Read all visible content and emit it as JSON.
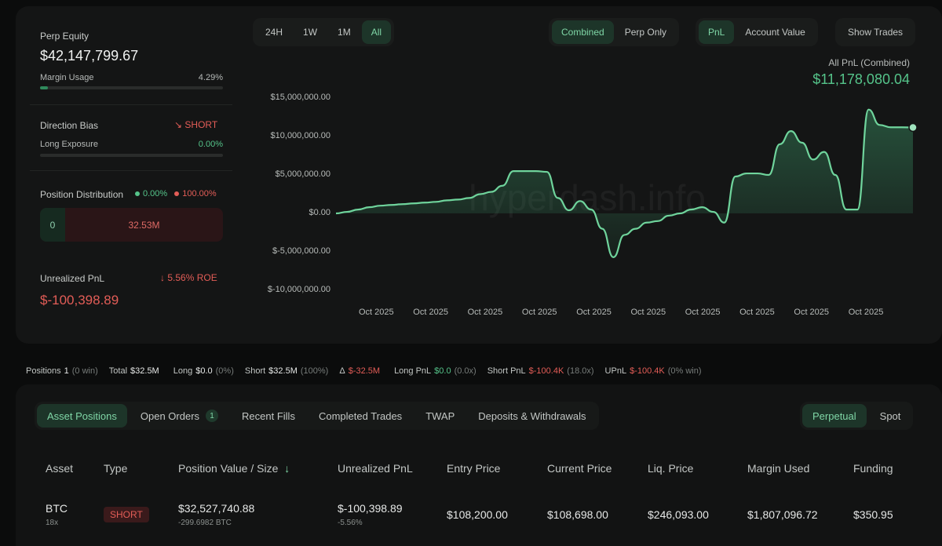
{
  "summary": {
    "perp_equity_label": "Perp Equity",
    "perp_equity_value": "$42,147,799.67",
    "margin_usage_label": "Margin Usage",
    "margin_usage_value": "4.29%",
    "margin_usage_fraction": 0.0429,
    "direction_bias_label": "Direction Bias",
    "direction_bias_value": "SHORT",
    "long_exposure_label": "Long Exposure",
    "long_exposure_value": "0.00%",
    "long_exposure_fraction": 0,
    "position_distribution_label": "Position Distribution",
    "dist_long_pct": "0.00%",
    "dist_short_pct": "100.00%",
    "dist_long_value": "0",
    "dist_short_value": "32.53M",
    "unrealized_pnl_label": "Unrealized PnL",
    "roe_value": "5.56% ROE",
    "unrealized_pnl_value": "$-100,398.89"
  },
  "time_range": {
    "options": [
      "24H",
      "1W",
      "1M",
      "All"
    ],
    "selected": "All"
  },
  "mode_toggle": {
    "options": [
      "Combined",
      "Perp Only"
    ],
    "selected": "Combined"
  },
  "metric_toggle": {
    "options": [
      "PnL",
      "Account Value"
    ],
    "selected": "PnL"
  },
  "show_trades_label": "Show Trades",
  "chart_header": {
    "label": "All PnL (Combined)",
    "value": "$11,178,080.04"
  },
  "watermark": "hyperdash.info",
  "colors": {
    "accent_green": "#55c48a",
    "negative_red": "#e35d57",
    "background": "#0b0c0c"
  },
  "chart_data": {
    "type": "area",
    "title": "",
    "xlabel": "",
    "ylabel": "",
    "ylim": [
      -10000000,
      15000000
    ],
    "y_ticks": [
      "$15,000,000.00",
      "$10,000,000.00",
      "$5,000,000.00",
      "$0.00",
      "$-5,000,000.00",
      "$-10,000,000.00"
    ],
    "y_tick_values": [
      15000000,
      10000000,
      5000000,
      0,
      -5000000,
      -10000000
    ],
    "x_ticks": [
      "Oct 2025",
      "Oct 2025",
      "Oct 2025",
      "Oct 2025",
      "Oct 2025",
      "Oct 2025",
      "Oct 2025",
      "Oct 2025",
      "Oct 2025",
      "Oct 2025"
    ],
    "series": [
      {
        "values": [
          0,
          200000,
          500000,
          800000,
          1000000,
          1100000,
          1200000,
          1300000,
          1400000,
          1500000,
          1700000,
          1800000,
          2000000,
          2500000,
          2800000,
          3600000,
          5500000,
          5500000,
          5500000,
          5400000,
          2000000,
          400000,
          1600000,
          500000,
          -2000000,
          -5700000,
          -2800000,
          -2000000,
          -1200000,
          -1000000,
          -300000,
          0,
          500000,
          800000,
          200000,
          -1200000,
          4800000,
          5200000,
          5200000,
          5000000,
          9000000,
          10700000,
          9200000,
          7000000,
          8000000,
          5000000,
          500000,
          500000,
          13500000,
          11500000,
          11200000,
          11200000,
          11178080
        ]
      }
    ]
  },
  "stats_bar": [
    {
      "k": "Positions",
      "v": "1",
      "m": "(0 win)"
    },
    {
      "k": "Total",
      "v": "$32.5M",
      "m": ""
    },
    {
      "k": "Long",
      "v": "$0.0",
      "m": "(0%)"
    },
    {
      "k": "Short",
      "v": "$32.5M",
      "m": "(100%)"
    },
    {
      "k": "Δ",
      "v": "$-32.5M",
      "m": "",
      "neg": true
    },
    {
      "k": "Long PnL",
      "v": "$0.0",
      "m": "(0.0x)",
      "pos": true
    },
    {
      "k": "Short PnL",
      "v": "$-100.4K",
      "m": "(18.0x)",
      "neg": true
    },
    {
      "k": "UPnL",
      "v": "$-100.4K",
      "m": "(0% win)",
      "neg": true
    }
  ],
  "tabs": {
    "items": [
      "Asset Positions",
      "Open Orders",
      "Recent Fills",
      "Completed Trades",
      "TWAP",
      "Deposits & Withdrawals"
    ],
    "open_orders_count": "1",
    "selected": "Asset Positions"
  },
  "market_toggle": {
    "options": [
      "Perpetual",
      "Spot"
    ],
    "selected": "Perpetual"
  },
  "table": {
    "headers": [
      "Asset",
      "Type",
      "Position Value / Size",
      "Unrealized PnL",
      "Entry Price",
      "Current Price",
      "Liq. Price",
      "Margin Used",
      "Funding"
    ],
    "sort_indicator": "↓",
    "row": {
      "asset": "BTC",
      "leverage": "18x",
      "type": "SHORT",
      "position_value": "$32,527,740.88",
      "size": "-299.6982 BTC",
      "unrealized_pnl": "$-100,398.89",
      "unrealized_pnl_pct": "-5.56%",
      "entry_price": "$108,200.00",
      "current_price": "$108,698.00",
      "liq_price": "$246,093.00",
      "margin_used": "$1,807,096.72",
      "funding": "$350.95"
    }
  }
}
